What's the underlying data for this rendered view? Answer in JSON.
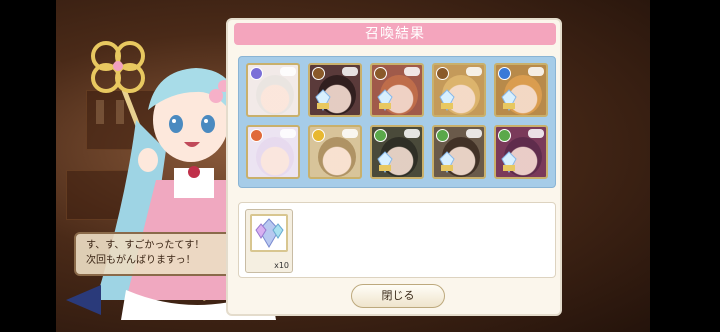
{
  "panel": {
    "title": "召喚結果"
  },
  "dialog": {
    "line1": "す、す、すごかったてす！",
    "line2": "次回もがんばりますっ！"
  },
  "cards": [
    {
      "attr": "moon",
      "attr_color": "#7b6fd8",
      "bg": "#f2eae8",
      "hair": "#e9e4e0",
      "crystal": false
    },
    {
      "attr": "earth",
      "attr_color": "#8a5a2a",
      "bg": "#5a3a3a",
      "hair": "#2a1a1a",
      "crystal": true
    },
    {
      "attr": "earth",
      "attr_color": "#8a5a2a",
      "bg": "#a05a4a",
      "hair": "#c4704a",
      "crystal": true
    },
    {
      "attr": "earth",
      "attr_color": "#8a5a2a",
      "bg": "#c49a5a",
      "hair": "#e0b870",
      "crystal": true
    },
    {
      "attr": "water",
      "attr_color": "#3a7ad8",
      "bg": "#b88a4a",
      "hair": "#e0a050",
      "crystal": true
    },
    {
      "attr": "fire",
      "attr_color": "#e06a3a",
      "bg": "#ece4f2",
      "hair": "#e6d8ee",
      "crystal": false
    },
    {
      "attr": "light",
      "attr_color": "#e8b830",
      "bg": "#d8c49a",
      "hair": "#a88a5a",
      "crystal": false
    },
    {
      "attr": "wind",
      "attr_color": "#5aa84a",
      "bg": "#4a4a3a",
      "hair": "#2a2a22",
      "crystal": true
    },
    {
      "attr": "wind",
      "attr_color": "#5aa84a",
      "bg": "#6a5a4a",
      "hair": "#3a2a20",
      "crystal": true
    },
    {
      "attr": "wind",
      "attr_color": "#5aa84a",
      "bg": "#7a3a5a",
      "hair": "#5a2a4a",
      "crystal": true
    }
  ],
  "item": {
    "count": "x10"
  },
  "buttons": {
    "close": "閉じる"
  }
}
